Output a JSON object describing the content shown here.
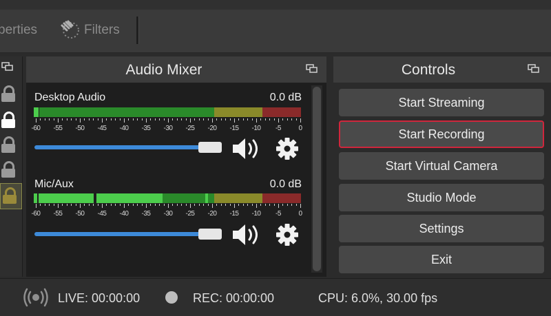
{
  "toolbar": {
    "properties_label": "perties",
    "filters_label": "Filters"
  },
  "audio_mixer": {
    "title": "Audio Mixer",
    "tick_labels": [
      "-60",
      "-55",
      "-50",
      "-45",
      "-40",
      "-35",
      "-30",
      "-25",
      "-20",
      "-15",
      "-10",
      "-5",
      "0"
    ],
    "channels": [
      {
        "name": "Desktop Audio",
        "db": "0.0 dB",
        "volume_fraction": 0.87
      },
      {
        "name": "Mic/Aux",
        "db": "0.0 dB",
        "volume_fraction": 0.87
      }
    ]
  },
  "controls": {
    "title": "Controls",
    "buttons": [
      "Start Streaming",
      "Start Recording",
      "Start Virtual Camera",
      "Studio Mode",
      "Settings",
      "Exit"
    ]
  },
  "status": {
    "live": "LIVE: 00:00:00",
    "rec": "REC: 00:00:00",
    "cpu": "CPU: 6.0%, 30.00 fps"
  },
  "colors": {
    "meter_green": "#2a8a2a",
    "meter_yellow": "#8a8a2a",
    "meter_red": "#8a2a2a",
    "volume_blue": "#3d8ad9",
    "highlight_red": "#d0263c"
  }
}
